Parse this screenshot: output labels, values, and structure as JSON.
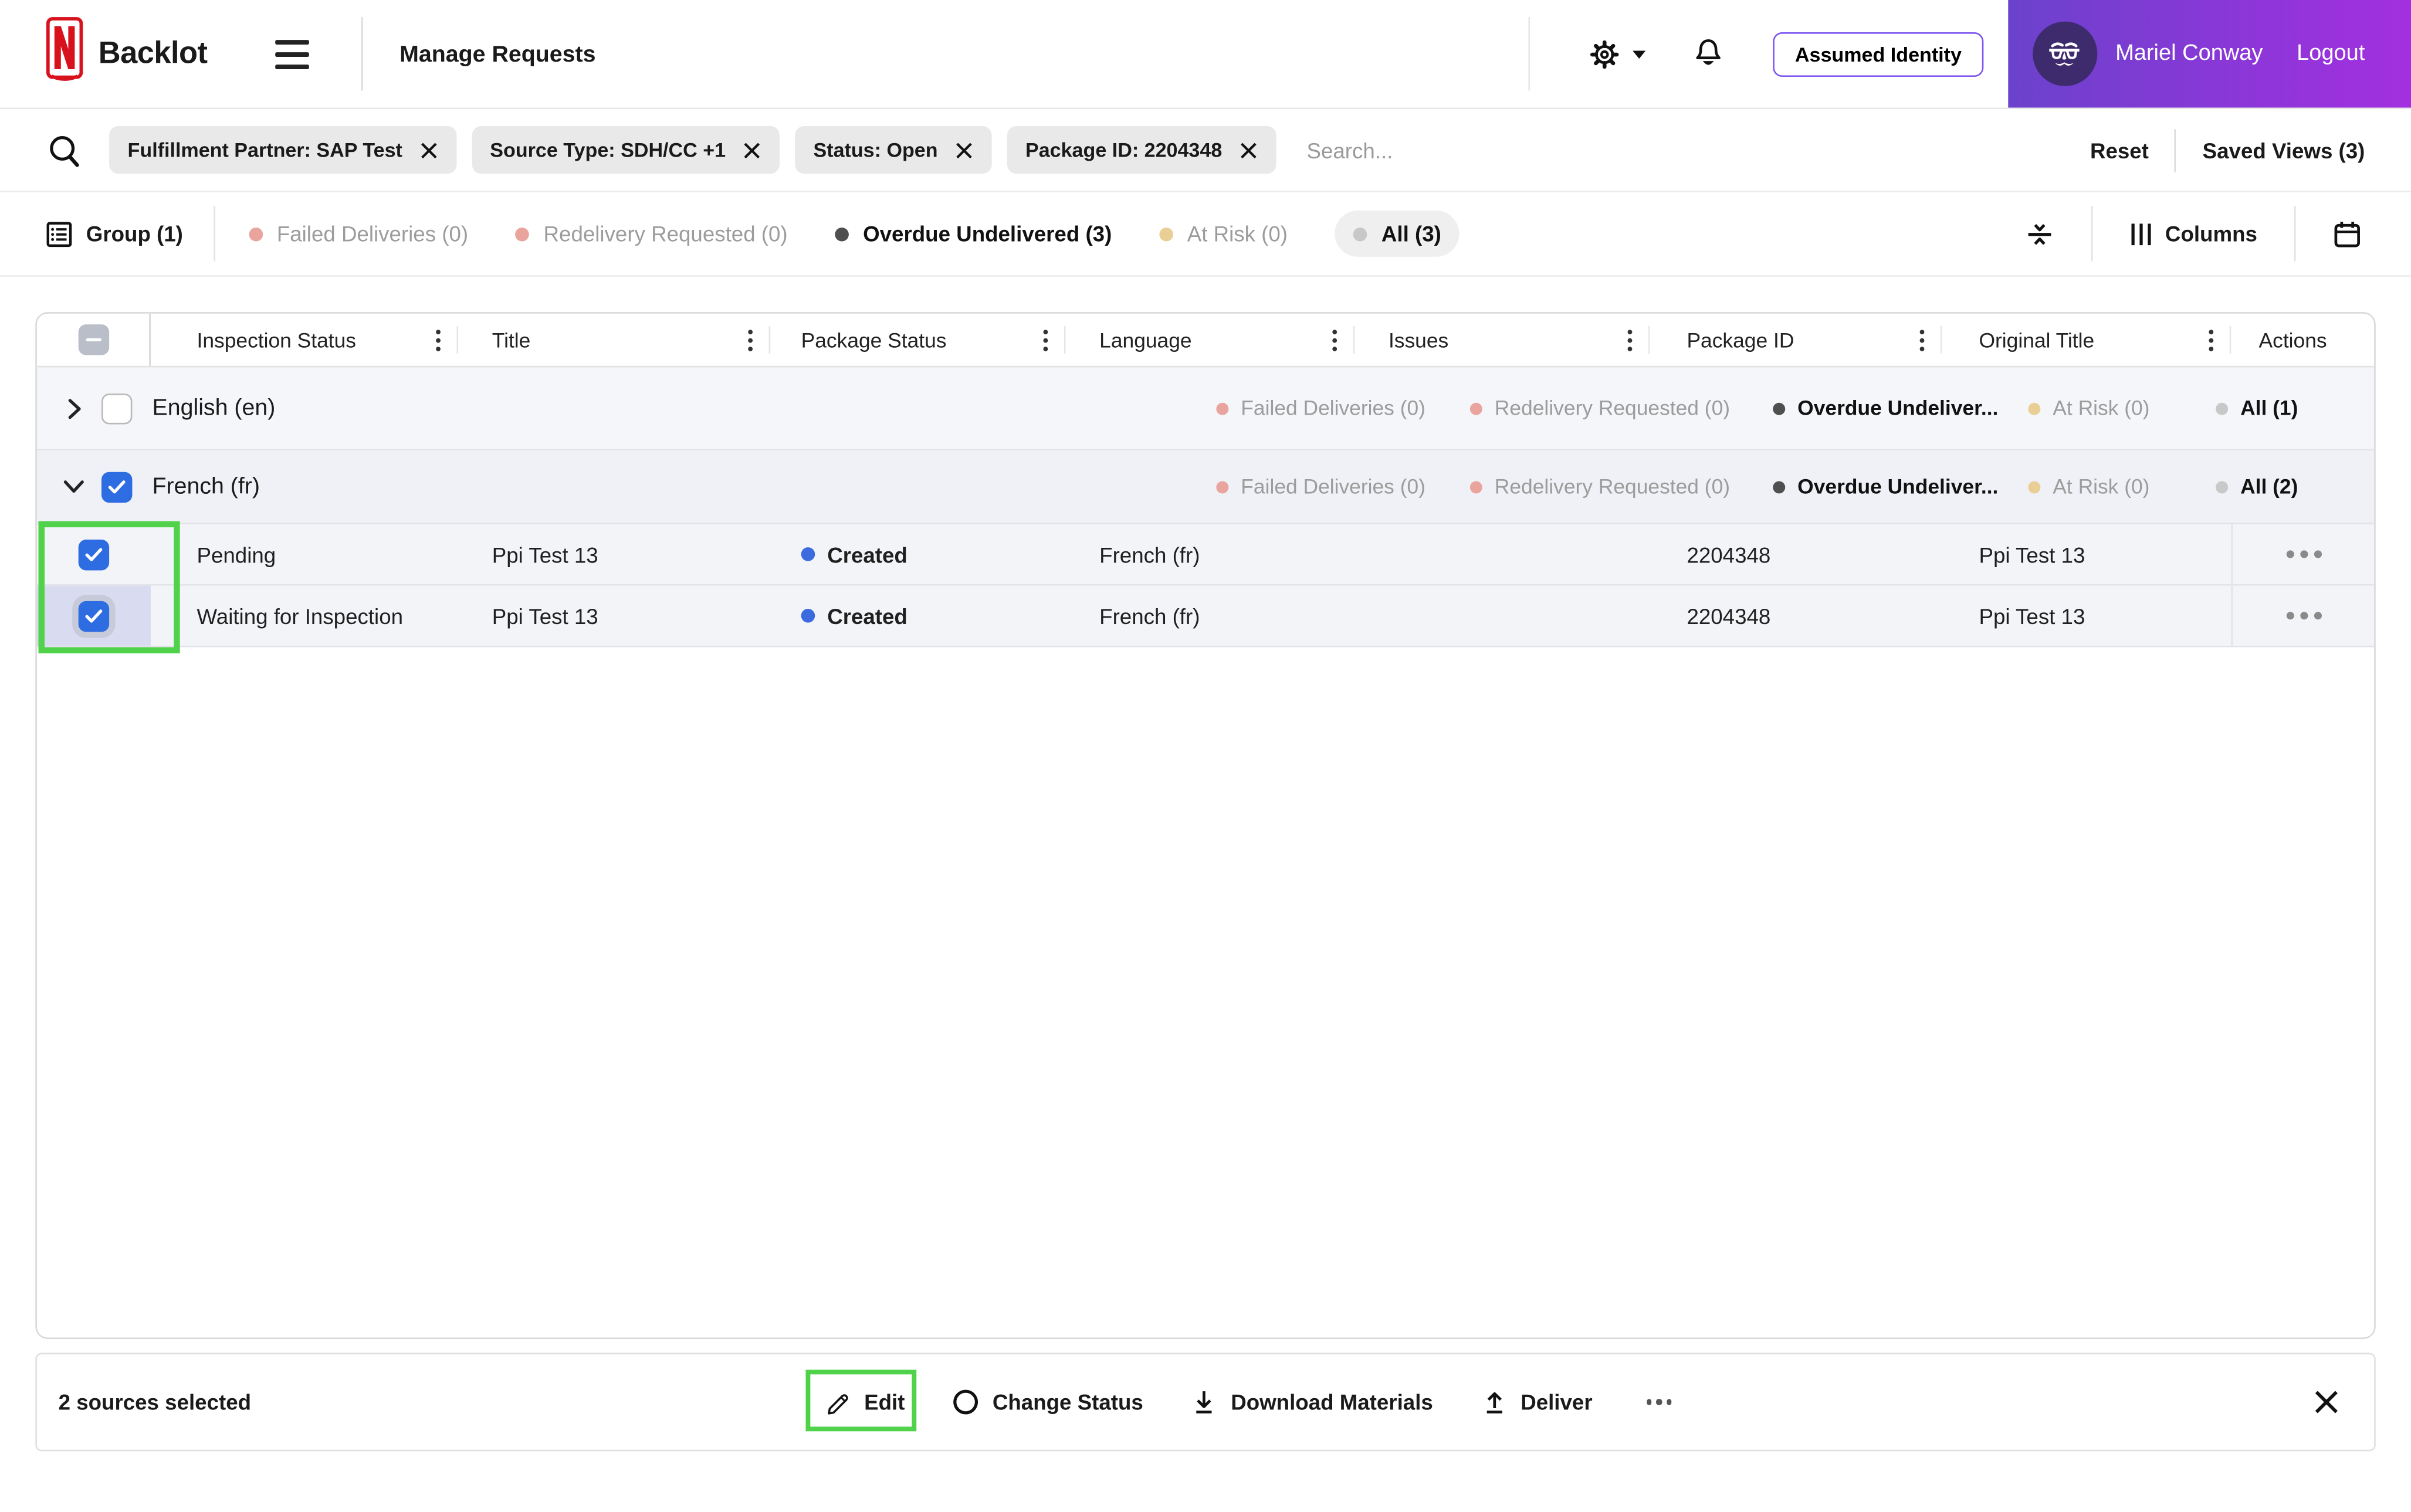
{
  "colors": {
    "accent_checkbox_blue": "#2e6ce2",
    "annotation_green": "#50d24b",
    "dot_failed_salmon": "#e9a49e",
    "dot_overdue_dark": "#4f4f4f",
    "dot_at_risk_tan": "#e9cf96",
    "dot_all_gray": "#c8c8c8",
    "dot_created_blue": "#3c6be0",
    "user_block_gradient_start": "#6b42cc",
    "user_block_gradient_end": "#a32fe0",
    "assumed_identity_border": "#7d55f0",
    "netflix_red": "#d8121c",
    "selected_cell_lavender": "#d9dbf0"
  },
  "header": {
    "app_name": "Backlot",
    "page_title": "Manage Requests",
    "assumed_identity": "Assumed Identity",
    "user_name": "Mariel Conway",
    "logout": "Logout"
  },
  "filter_bar": {
    "chips": [
      {
        "label": "Fulfillment Partner: SAP Test"
      },
      {
        "label": "Source Type: SDH/CC +1"
      },
      {
        "label": "Status: Open"
      },
      {
        "label": "Package ID: 2204348"
      }
    ],
    "search_placeholder": "Search...",
    "reset": "Reset",
    "saved_views": "Saved Views (3)"
  },
  "toolbar": {
    "group": "Group (1)",
    "tabs": [
      {
        "label": "Failed Deliveries (0)"
      },
      {
        "label": "Redelivery Requested (0)"
      },
      {
        "label": "Overdue Undelivered (3)"
      },
      {
        "label": "At Risk (0)"
      },
      {
        "label": "All (3)"
      }
    ],
    "columns": "Columns"
  },
  "table": {
    "headers": [
      "Inspection Status",
      "Title",
      "Package Status",
      "Language",
      "Issues",
      "Package ID",
      "Original Title",
      "Actions"
    ],
    "groups": [
      {
        "label": "English (en)",
        "badges": [
          {
            "label": "Failed Deliveries (0)"
          },
          {
            "label": "Redelivery Requested (0)"
          },
          {
            "label": "Overdue Undeliver..."
          },
          {
            "label": "At Risk (0)"
          },
          {
            "label": "All (1)"
          }
        ]
      },
      {
        "label": "French (fr)",
        "badges": [
          {
            "label": "Failed Deliveries (0)"
          },
          {
            "label": "Redelivery Requested (0)"
          },
          {
            "label": "Overdue Undeliver..."
          },
          {
            "label": "At Risk (0)"
          },
          {
            "label": "All (2)"
          }
        ]
      }
    ],
    "rows": [
      {
        "inspection_status": "Pending",
        "title": "Ppi Test 13",
        "package_status": "Created",
        "language": "French (fr)",
        "issues": "",
        "package_id": "2204348",
        "original_title": "Ppi Test 13"
      },
      {
        "inspection_status": "Waiting for Inspection",
        "title": "Ppi Test 13",
        "package_status": "Created",
        "language": "French (fr)",
        "issues": "",
        "package_id": "2204348",
        "original_title": "Ppi Test 13"
      }
    ]
  },
  "action_bar": {
    "selection": "2 sources selected",
    "edit": "Edit",
    "change_status": "Change Status",
    "download_materials": "Download Materials",
    "deliver": "Deliver"
  }
}
